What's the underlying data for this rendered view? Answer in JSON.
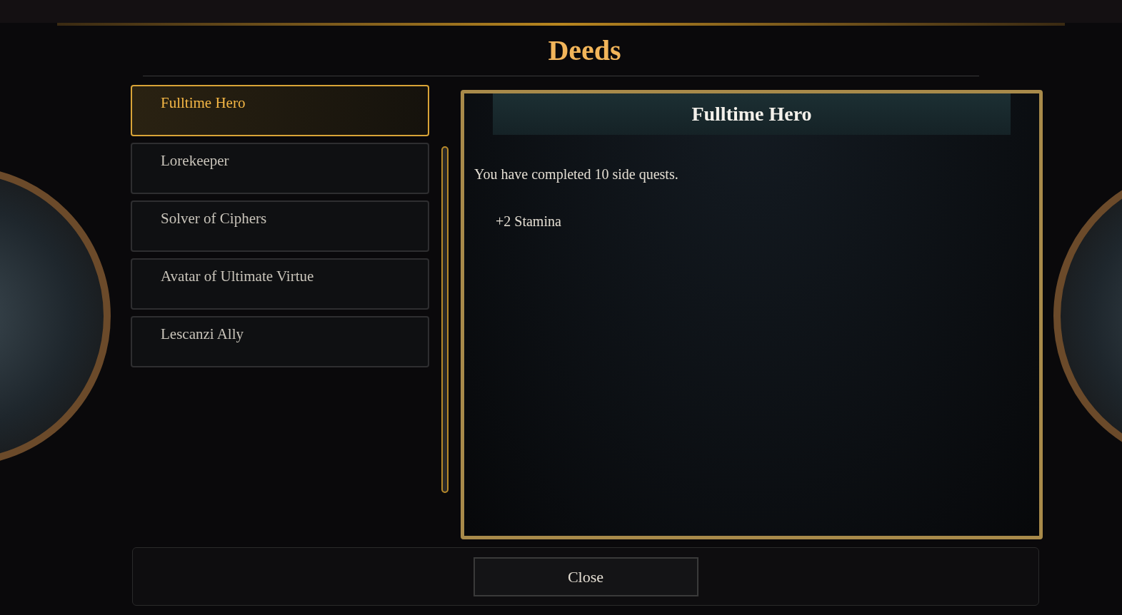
{
  "title": "Deeds",
  "deeds": [
    {
      "name": "Fulltime Hero",
      "selected": true
    },
    {
      "name": "Lorekeeper",
      "selected": false
    },
    {
      "name": "Solver of Ciphers",
      "selected": false
    },
    {
      "name": "Avatar of Ultimate Virtue",
      "selected": false
    },
    {
      "name": "Lescanzi Ally",
      "selected": false
    }
  ],
  "detail": {
    "title": "Fulltime Hero",
    "description": "You have completed 10 side quests.",
    "rewards": [
      "+2 Stamina"
    ]
  },
  "close_button": "Close"
}
